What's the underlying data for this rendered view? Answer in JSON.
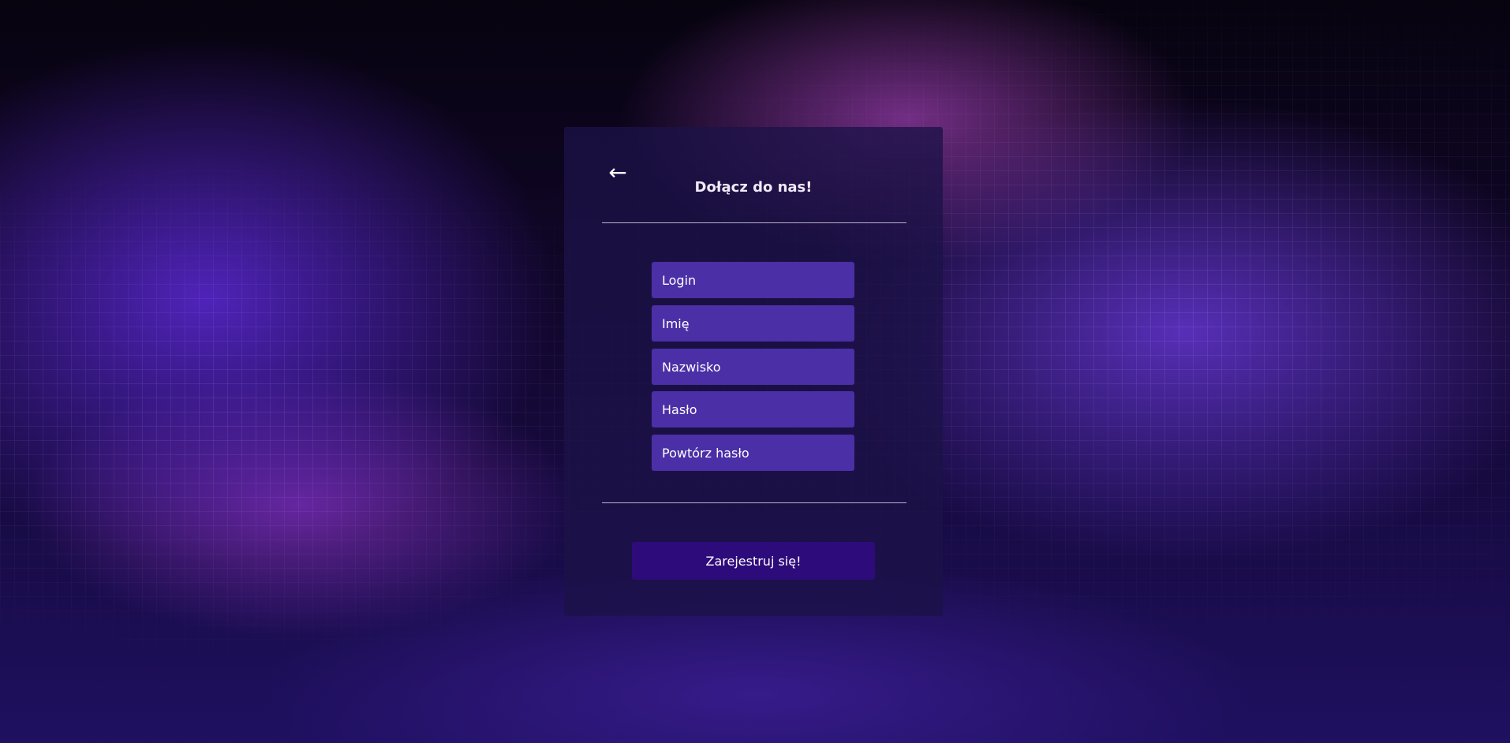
{
  "form": {
    "back_icon": "left-arrow-icon",
    "back_glyph": "←",
    "title": "Dołącz do nas!",
    "fields": [
      {
        "name": "login",
        "placeholder": "Login",
        "value": ""
      },
      {
        "name": "first-name",
        "placeholder": "Imię",
        "value": ""
      },
      {
        "name": "last-name",
        "placeholder": "Nazwisko",
        "value": ""
      },
      {
        "name": "password",
        "placeholder": "Hasło",
        "value": ""
      },
      {
        "name": "repeat-password",
        "placeholder": "Powtórz hasło",
        "value": ""
      }
    ],
    "submit_label": "Zarejestruj się!"
  },
  "colors": {
    "card": "#1c1248",
    "field": "#4b2fa6",
    "button": "#2e0b7b",
    "text": "#ffffff"
  }
}
